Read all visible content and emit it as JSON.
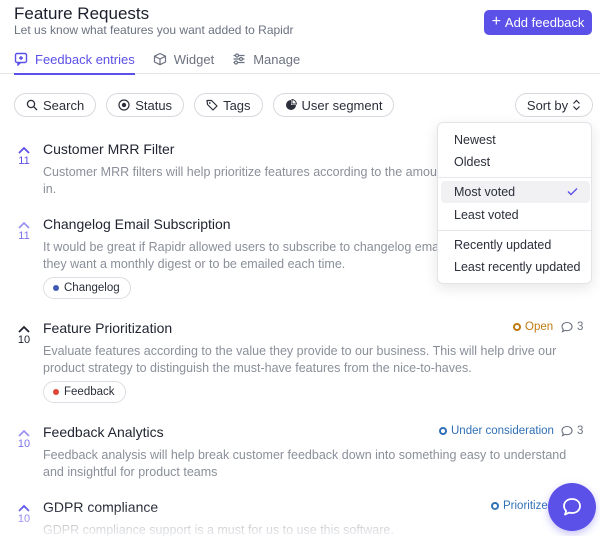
{
  "header": {
    "title": "Feature Requests",
    "subtitle": "Let us know what features you want added to Rapidr",
    "add_button": "Add feedback"
  },
  "tabs": [
    {
      "label": "Feedback entries",
      "active": true,
      "icon": "feedback-icon"
    },
    {
      "label": "Widget",
      "active": false,
      "icon": "cube-icon"
    },
    {
      "label": "Manage",
      "active": false,
      "icon": "sliders-icon"
    }
  ],
  "filters": [
    {
      "label": "Search",
      "icon": "search-icon"
    },
    {
      "label": "Status",
      "icon": "status-icon"
    },
    {
      "label": "Tags",
      "icon": "tag-icon"
    },
    {
      "label": "User segment",
      "icon": "pie-icon"
    }
  ],
  "sort": {
    "label": "Sort by"
  },
  "sort_menu": {
    "items": [
      "Newest",
      "Oldest",
      "Most voted",
      "Least voted",
      "Recently updated",
      "Least recently updated"
    ],
    "selected": "Most voted"
  },
  "entries": [
    {
      "votes": "11",
      "title": "Customer MRR Filter",
      "description": "Customer MRR filters will help prioritize features according to the amount of revenue it will bring in."
    },
    {
      "votes": "11",
      "title": "Changelog Email Subscription",
      "description": "It would be great if Rapidr allowed users to subscribe to changelog email updates, and choose if they want a monthly digest or to be emailed each time.",
      "tag": "Changelog"
    },
    {
      "votes": "10",
      "title": "Feature Prioritization",
      "description": "Evaluate features according to the value they provide to our business. This will help drive our product strategy to distinguish the must-have features from the nice-to-haves.",
      "tag": "Feedback",
      "status": "Open",
      "comments": "3"
    },
    {
      "votes": "10",
      "title": "Feedback Analytics",
      "description": "Feedback analysis will help break customer feedback down into something easy to understand and insightful for product teams",
      "status": "Under consideration",
      "comments": "3"
    },
    {
      "votes": "10",
      "title": "GDPR compliance",
      "description": "GDPR compliance support is a must for us to use this software.",
      "status": "Prioritized"
    }
  ],
  "colors": {
    "accent": "#5b50e8",
    "open": "#c07a12",
    "under_consideration": "#2f6fb5",
    "changelog_dot": "#3b5bb5",
    "feedback_dot": "#e0453a"
  }
}
